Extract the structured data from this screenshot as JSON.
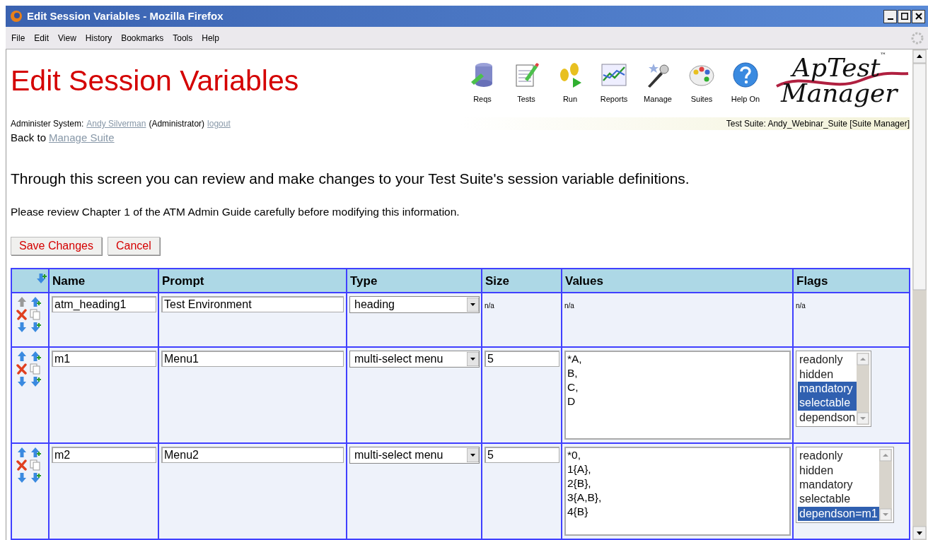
{
  "window": {
    "title": "Edit Session Variables - Mozilla Firefox"
  },
  "menu": [
    "File",
    "Edit",
    "View",
    "History",
    "Bookmarks",
    "Tools",
    "Help"
  ],
  "page_title": "Edit Session Variables",
  "nav": [
    {
      "label": "Reqs"
    },
    {
      "label": "Tests"
    },
    {
      "label": "Run"
    },
    {
      "label": "Reports"
    },
    {
      "label": "Manage"
    },
    {
      "label": "Suites"
    },
    {
      "label": "Help On"
    }
  ],
  "logo": {
    "line1": "ApTest",
    "line2": "Manager",
    "mark": "™"
  },
  "admin": {
    "prefix": "Administer System:",
    "user": "Andy Silverman",
    "role": "(Administrator)",
    "logout": "logout"
  },
  "suite": "Test Suite: Andy_Webinar_Suite [Suite Manager]",
  "back": {
    "prefix": "Back to",
    "link": "Manage Suite"
  },
  "intro": "Through this screen you can review and make changes to your Test Suite's session variable definitions.",
  "note": "Please review Chapter 1 of the ATM Admin Guide carefully before modifying this information.",
  "buttons": [
    "Save Changes",
    "Cancel"
  ],
  "table": {
    "columns": [
      "Name",
      "Prompt",
      "Type",
      "Size",
      "Values",
      "Flags"
    ],
    "rows": [
      {
        "kind": "heading",
        "can_move_up": false,
        "name": "atm_heading1",
        "prompt": "Test Environment",
        "type": "heading",
        "size": "n/a",
        "values": "n/a",
        "flags_text": "n/a"
      },
      {
        "kind": "menu",
        "can_move_up": true,
        "name": "m1",
        "prompt": "Menu1",
        "type": "multi-select menu",
        "size": "5",
        "values": "*A,\nB,\nC,\nD",
        "flags": [
          {
            "label": "readonly",
            "selected": false
          },
          {
            "label": "hidden",
            "selected": false
          },
          {
            "label": "mandatory",
            "selected": true
          },
          {
            "label": "selectable",
            "selected": true
          },
          {
            "label": "dependson",
            "selected": false
          }
        ]
      },
      {
        "kind": "menu",
        "can_move_up": true,
        "name": "m2",
        "prompt": "Menu2",
        "type": "multi-select menu",
        "size": "5",
        "values": "*0,\n1{A},\n2{B},\n3{A,B},\n4{B}",
        "flags": [
          {
            "label": "readonly",
            "selected": false
          },
          {
            "label": "hidden",
            "selected": false
          },
          {
            "label": "mandatory",
            "selected": false
          },
          {
            "label": "selectable",
            "selected": false
          },
          {
            "label": "dependson=m1",
            "selected": true
          }
        ]
      }
    ]
  }
}
